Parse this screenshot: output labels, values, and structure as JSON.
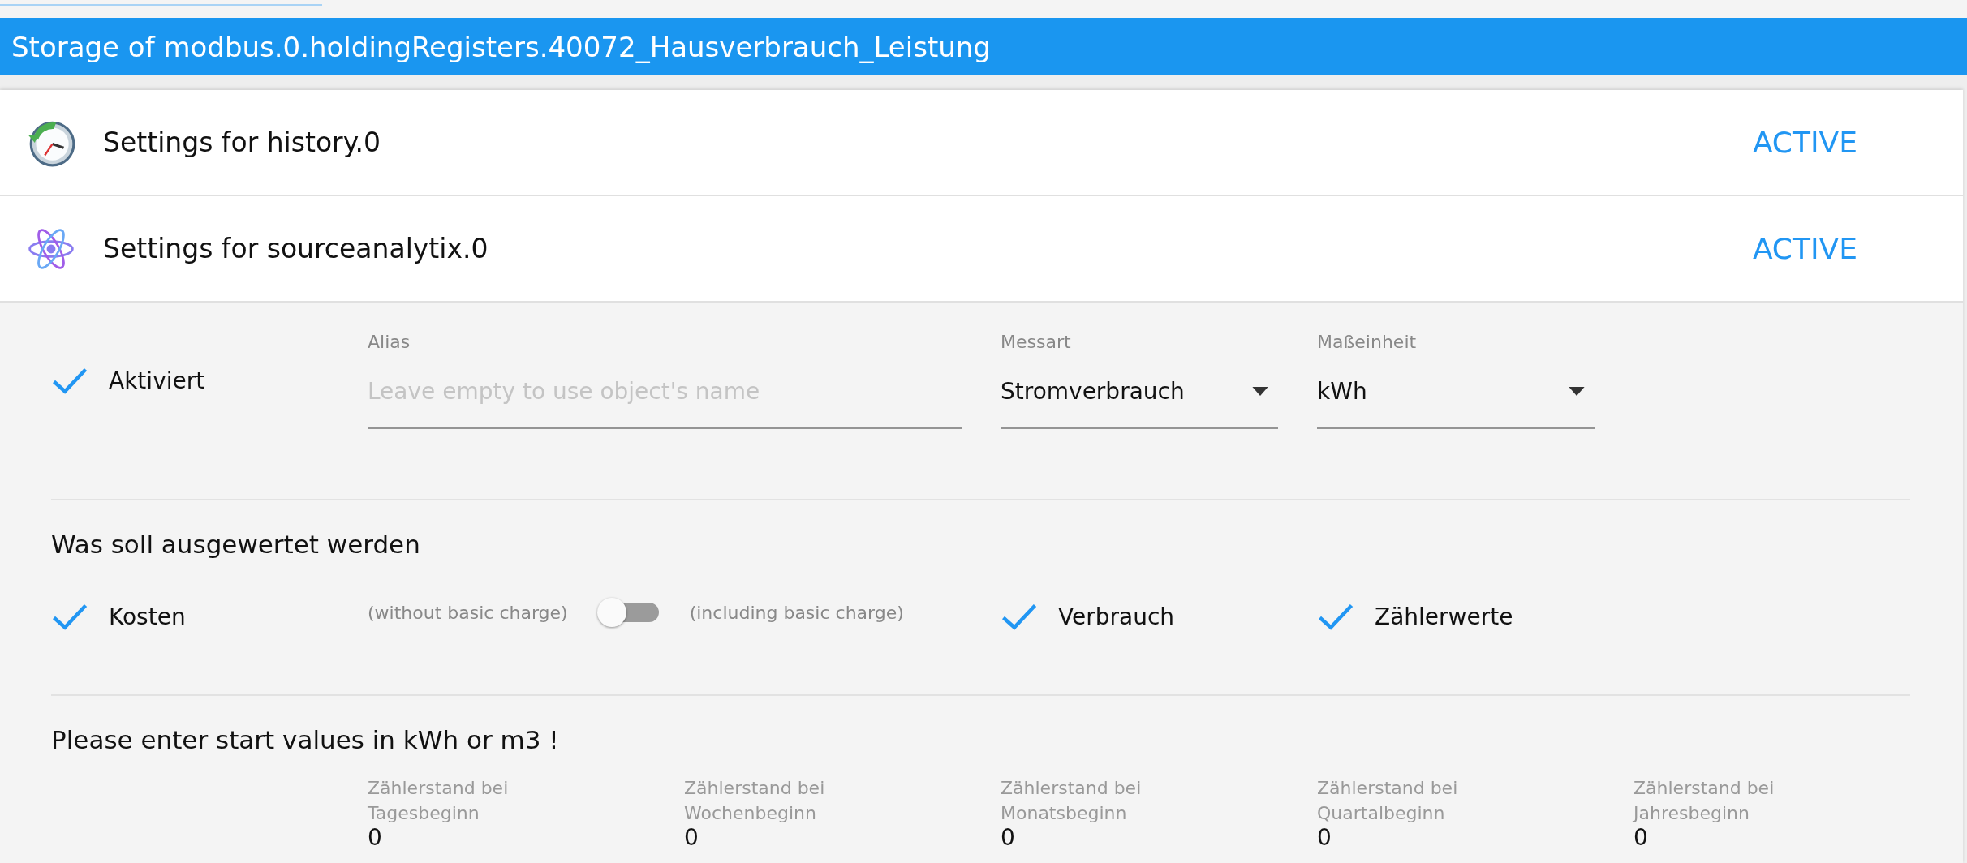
{
  "title": "Storage of modbus.0.holdingRegisters.40072_Hausverbrauch_Leistung",
  "sections": [
    {
      "kind": "clock",
      "label": "Settings for history.0",
      "status": "ACTIVE"
    },
    {
      "kind": "atom",
      "label": "Settings for sourceanalytix.0",
      "status": "ACTIVE"
    }
  ],
  "activated": {
    "label": "Aktiviert",
    "checked": true
  },
  "fields": [
    {
      "kind": "text",
      "label": "Alias",
      "placeholder": "Leave empty to use object's name"
    },
    {
      "kind": "select",
      "label": "Messart",
      "value": "Stromverbrauch"
    },
    {
      "kind": "select",
      "label": "Maßeinheit",
      "value": "kWh"
    }
  ],
  "evaluate": {
    "heading": "Was soll ausgewertet werden",
    "items": [
      {
        "kind": "checkbox",
        "label": "Kosten",
        "checked": true
      },
      {
        "kind": "toggle",
        "off_label": "(without basic charge)",
        "on_label": "(including basic charge)",
        "on": false
      },
      {
        "kind": "checkbox",
        "label": "Verbrauch",
        "checked": true
      },
      {
        "kind": "checkbox",
        "label": "Zählerwerte",
        "checked": true
      }
    ]
  },
  "start_values": {
    "heading": "Please enter start values in kWh or m3 !",
    "fields": [
      {
        "label": "Zählerstand bei Tagesbeginn",
        "value": "0"
      },
      {
        "label": "Zählerstand bei Wochenbeginn",
        "value": "0"
      },
      {
        "label": "Zählerstand bei Monatsbeginn",
        "value": "0"
      },
      {
        "label": "Zählerstand bei Quartalbeginn",
        "value": "0"
      },
      {
        "label": "Zählerstand bei Jahresbeginn",
        "value": "0"
      }
    ]
  }
}
